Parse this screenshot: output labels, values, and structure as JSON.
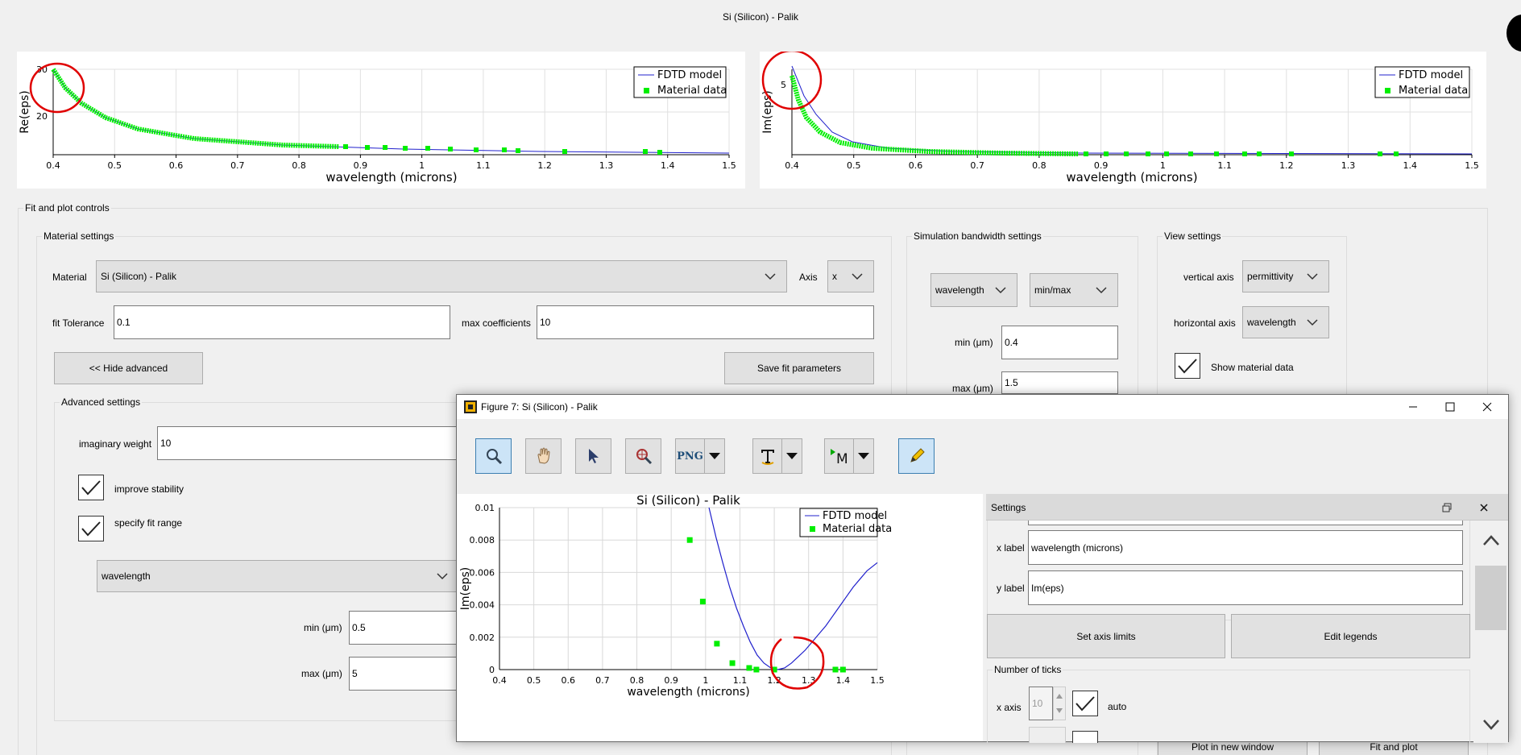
{
  "window_title": "Si (Silicon) - Palik",
  "top_plots": {
    "left": {
      "ylabel": "Re(eps)",
      "xlabel": "wavelength (microns)",
      "yticks": [
        "20",
        "30"
      ]
    },
    "right": {
      "ylabel": "Im(eps)",
      "xlabel": "wavelength (microns)",
      "yticks": [
        "5"
      ]
    },
    "xticks": [
      "0.4",
      "0.5",
      "0.6",
      "0.7",
      "0.8",
      "0.9",
      "1",
      "1.1",
      "1.2",
      "1.3",
      "1.4",
      "1.5"
    ],
    "legend": [
      "FDTD model",
      "Material data"
    ]
  },
  "fit_controls": {
    "title": "Fit and plot controls",
    "material_settings": {
      "title": "Material settings",
      "material_label": "Material",
      "material_value": "Si (Silicon) - Palik",
      "axis_label": "Axis",
      "axis_value": "x",
      "fit_tolerance_label": "fit Tolerance",
      "fit_tolerance_value": "0.1",
      "max_coefficients_label": "max coefficients",
      "max_coefficients_value": "10",
      "hide_advanced_label": "<< Hide advanced",
      "save_fit_label": "Save fit parameters"
    },
    "advanced": {
      "title": "Advanced settings",
      "imag_weight_label": "imaginary weight",
      "imag_weight_value": "10",
      "improve_stability_label": "improve stability",
      "specify_fit_range_label": "specify fit range",
      "range_unit": "wavelength",
      "min_label": "min (μm)",
      "min_value": "0.5",
      "max_label": "max (μm)",
      "max_value": "5"
    },
    "simulation": {
      "title": "Simulation bandwidth settings",
      "unit": "wavelength",
      "mode": "min/max",
      "min_label": "min (μm)",
      "min_value": "0.4",
      "max_label": "max (μm)",
      "max_value": "1.5"
    },
    "view": {
      "title": "View settings",
      "vertical_label": "vertical axis",
      "vertical_value": "permittivity",
      "horizontal_label": "horizontal axis",
      "horizontal_value": "wavelength",
      "show_material_label": "Show material data"
    },
    "bottom_buttons": {
      "plot_new": "Plot in new window",
      "fit_plot": "Fit and plot"
    }
  },
  "figure_window": {
    "title": "Figure 7: Si (Silicon) - Palik",
    "toolbar": {
      "png_label": "PNG"
    },
    "settings": {
      "title": "Settings",
      "x_label_label": "x label",
      "x_label_value": "wavelength (microns)",
      "y_label_label": "y label",
      "y_label_value": "Im(eps)",
      "set_axis_limits": "Set axis limits",
      "edit_legends": "Edit legends",
      "number_of_ticks": "Number of ticks",
      "x_axis_label": "x axis",
      "x_axis_ticks": "10",
      "auto_label": "auto"
    }
  },
  "chart_data": {
    "type": "scatter",
    "title": "Si (Silicon) - Palik",
    "xlabel": "wavelength (microns)",
    "ylabel": "Im(eps)",
    "xlim": [
      0.4,
      1.5
    ],
    "ylim": [
      0,
      0.01
    ],
    "xticks": [
      "0.4",
      "0.5",
      "0.6",
      "0.7",
      "0.8",
      "0.9",
      "1",
      "1.1",
      "1.2",
      "1.3",
      "1.4",
      "1.5"
    ],
    "yticks": [
      "0",
      "0.002",
      "0.004",
      "0.006",
      "0.008",
      "0.01"
    ],
    "grid": true,
    "legend_position": "top-right",
    "series": [
      {
        "name": "FDTD model",
        "kind": "line",
        "color": "#2020cc",
        "x": [
          1.01,
          1.03,
          1.05,
          1.07,
          1.09,
          1.11,
          1.13,
          1.15,
          1.17,
          1.19,
          1.21,
          1.23,
          1.25,
          1.27,
          1.29,
          1.31,
          1.33,
          1.35,
          1.37,
          1.39,
          1.41,
          1.43,
          1.45,
          1.47,
          1.5
        ],
        "y": [
          0.01,
          0.0082,
          0.0066,
          0.0051,
          0.0038,
          0.0027,
          0.0017,
          0.0009,
          0.0004,
          0.0001,
          0.0,
          0.0001,
          0.0004,
          0.0008,
          0.0012,
          0.0017,
          0.0022,
          0.0027,
          0.0033,
          0.0039,
          0.0045,
          0.0051,
          0.0056,
          0.0061,
          0.0066
        ]
      },
      {
        "name": "Material data",
        "kind": "scatter",
        "color": "#00ee00",
        "x": [
          0.954,
          0.992,
          1.033,
          1.078,
          1.127,
          1.148,
          1.2,
          1.378,
          1.4
        ],
        "y": [
          0.008,
          0.0042,
          0.0016,
          0.0004,
          0.0001,
          0.0,
          0.0,
          0.0,
          0.0
        ]
      }
    ]
  }
}
